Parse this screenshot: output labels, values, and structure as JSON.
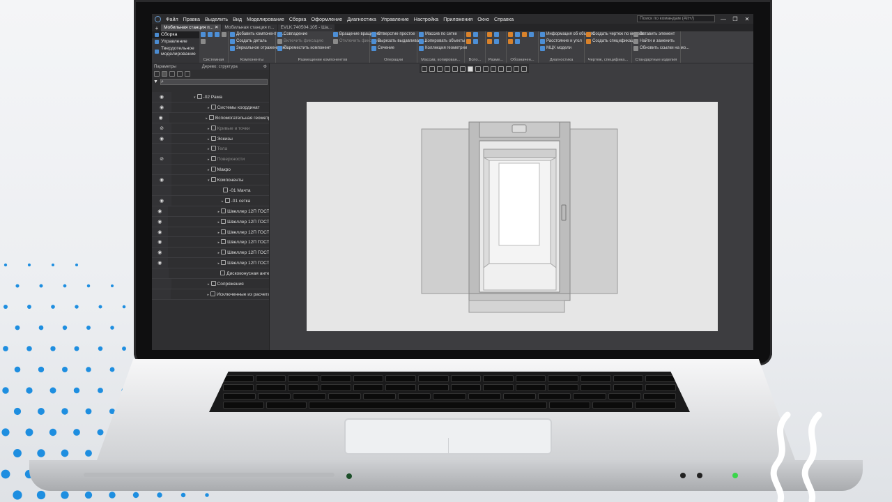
{
  "menu": [
    "Файл",
    "Правка",
    "Выделить",
    "Вид",
    "Моделирование",
    "Сборка",
    "Оформление",
    "Диагностика",
    "Управление",
    "Настройка",
    "Приложения",
    "Окно",
    "Справка"
  ],
  "search": {
    "placeholder": "Поиск по командам (Alt+/)"
  },
  "window_controls": {
    "minimize": "—",
    "maximize": "❐",
    "close": "✕"
  },
  "tabs": [
    {
      "label": "Мобильная станция п...",
      "active": true,
      "close": "✕"
    },
    {
      "label": "Мобильная станция п...",
      "active": false
    },
    {
      "label": "EVLK.740504.105 - Ша...",
      "active": false
    }
  ],
  "ribbon": {
    "left_items": [
      "Сборка",
      "Управление",
      "Твердотельное моделирование"
    ],
    "groups": [
      {
        "label": "Системная",
        "buttons": []
      },
      {
        "label": "Компоненты",
        "buttons": [
          "Добавить компонент из...",
          "Создать деталь",
          "Зеркальное отражение ко..."
        ]
      },
      {
        "label": "Размещение компонентов",
        "buttons": [
          "Совпадение",
          "Вращение вращение",
          "Включить фиксацию",
          "Отключить фиксацию",
          "Переместить компонент"
        ]
      },
      {
        "label": "Операции",
        "buttons": [
          "Отверстие простое",
          "Вырезать выдавливани...",
          "Сечение"
        ]
      },
      {
        "label": "Массив, копирован...",
        "buttons": [
          "Массив по сетке",
          "Копировать объекты",
          "Коллекция геометрии"
        ]
      },
      {
        "label": "Вспо...",
        "buttons": []
      },
      {
        "label": "Разме...",
        "buttons": []
      },
      {
        "label": "Обозначен...",
        "buttons": []
      },
      {
        "label": "Диагностика",
        "buttons": [
          "Информация об объекте",
          "Расстояние и угол",
          "МЦХ модели"
        ]
      },
      {
        "label": "Чертеж, специфика...",
        "buttons": [
          "Создать чертеж по модели",
          "Создать спецификац..."
        ]
      },
      {
        "label": "Стандартные изделия",
        "buttons": [
          "Вставить элемент",
          "Найти и заменить",
          "Обновить ссылки на мо..."
        ]
      }
    ]
  },
  "panel": {
    "title_left": "Параметры",
    "title_right": "Дерево: структура",
    "settings_icon": "⚙",
    "filter_icon": "▼",
    "search_icon": "⌕"
  },
  "tree": [
    {
      "label": "-02 Рама",
      "indent": 1,
      "eye": true,
      "arrow": "▾"
    },
    {
      "label": "Системы координат",
      "indent": 2,
      "eye": true,
      "arrow": "▸"
    },
    {
      "label": "Вспомогательная геометрия",
      "indent": 2,
      "eye": true,
      "arrow": "▸"
    },
    {
      "label": "Кривые и точки",
      "indent": 2,
      "eye": "hidden",
      "arrow": "▸",
      "dim": true
    },
    {
      "label": "Эскизы",
      "indent": 2,
      "eye": true,
      "arrow": "▸"
    },
    {
      "label": "Тела",
      "indent": 2,
      "eye": false,
      "arrow": "▸",
      "dim": true
    },
    {
      "label": "Поверхности",
      "indent": 2,
      "eye": "hidden",
      "arrow": "▸",
      "dim": true
    },
    {
      "label": "Макро",
      "indent": 2,
      "eye": false,
      "arrow": "▸"
    },
    {
      "label": "Компоненты",
      "indent": 2,
      "eye": true,
      "arrow": "▾"
    },
    {
      "label": "-01 Мачта",
      "indent": 3,
      "eye": false,
      "arrow": ""
    },
    {
      "label": "-01 сетка",
      "indent": 3,
      "eye": true,
      "arrow": "▸"
    },
    {
      "label": "Швеллер 12П ГОСТ 8240",
      "indent": 3,
      "eye": true,
      "arrow": "▸"
    },
    {
      "label": "Швеллер 12П ГОСТ 8240",
      "indent": 3,
      "eye": true,
      "arrow": "▸"
    },
    {
      "label": "Швеллер 12П ГОСТ 8240",
      "indent": 3,
      "eye": true,
      "arrow": "▸"
    },
    {
      "label": "Швеллер 12П ГОСТ 8240",
      "indent": 3,
      "eye": true,
      "arrow": "▸"
    },
    {
      "label": "Швеллер 12П ГОСТ 8240",
      "indent": 3,
      "eye": true,
      "arrow": "▸"
    },
    {
      "label": "Швеллер 12П ГОСТ 8240",
      "indent": 3,
      "eye": true,
      "arrow": "▸"
    },
    {
      "label": "Дискоконусная антенна",
      "indent": 3,
      "eye": false,
      "arrow": ""
    },
    {
      "label": "Сопряжения",
      "indent": 2,
      "eye": false,
      "arrow": "▸"
    },
    {
      "label": "Исключенные из расчета",
      "indent": 2,
      "eye": false,
      "arrow": "▸"
    }
  ],
  "colors": {
    "accent": "#4b8bd0",
    "dots": "#1e8ee0",
    "led_green": "#3ad64a"
  }
}
